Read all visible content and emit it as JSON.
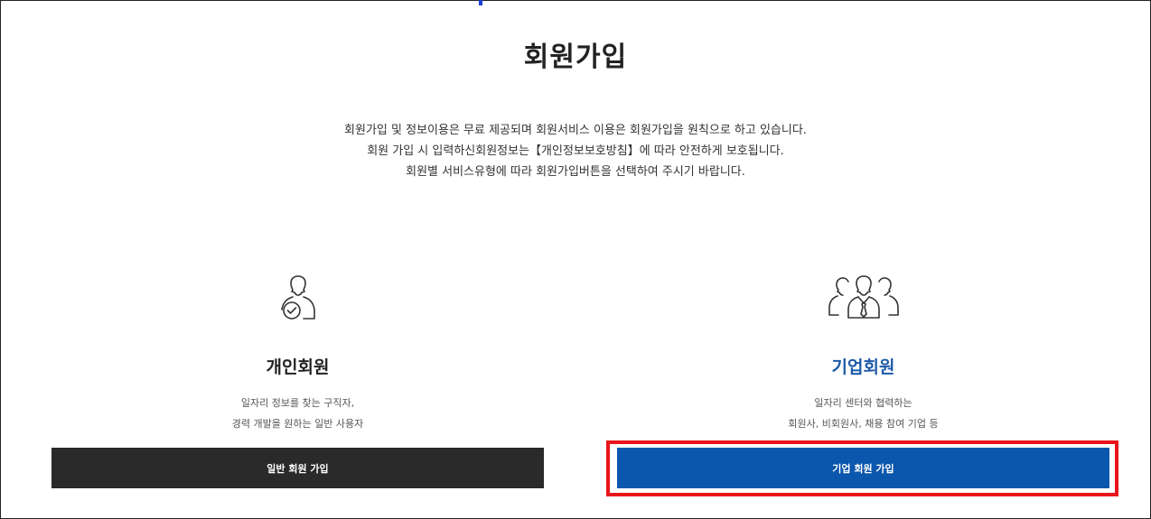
{
  "page": {
    "title": "회원가입",
    "intro_lines": [
      "회원가입 및 정보이용은 무료 제공되며 회원서비스 이용은 회원가입을 원칙으로 하고 있습니다.",
      "회원 가입 시 입력하신회원정보는【개인정보보호방침】에 따라 안전하게 보호됩니다.",
      "회원별 서비스유형에 따라 회원가입버튼을 선택하여 주시기 바랍니다."
    ]
  },
  "personal": {
    "icon": "person-check-icon",
    "title": "개인회원",
    "desc_lines": [
      "일자리 정보를 찾는 구직자,",
      "경력 개발을 원하는 일반 사용자"
    ],
    "button_label": "일반 회원 가입",
    "button_color": "#2a2a2a"
  },
  "corporate": {
    "icon": "group-tie-icon",
    "title": "기업회원",
    "title_color": "#1e5aa8",
    "desc_lines": [
      "일자리 센터와 협력하는",
      "회원사, 비회원사, 채용 참여 기업 등"
    ],
    "button_label": "기업 회원 가입",
    "button_color": "#0a57ad"
  },
  "highlight_color": "#e8151b"
}
